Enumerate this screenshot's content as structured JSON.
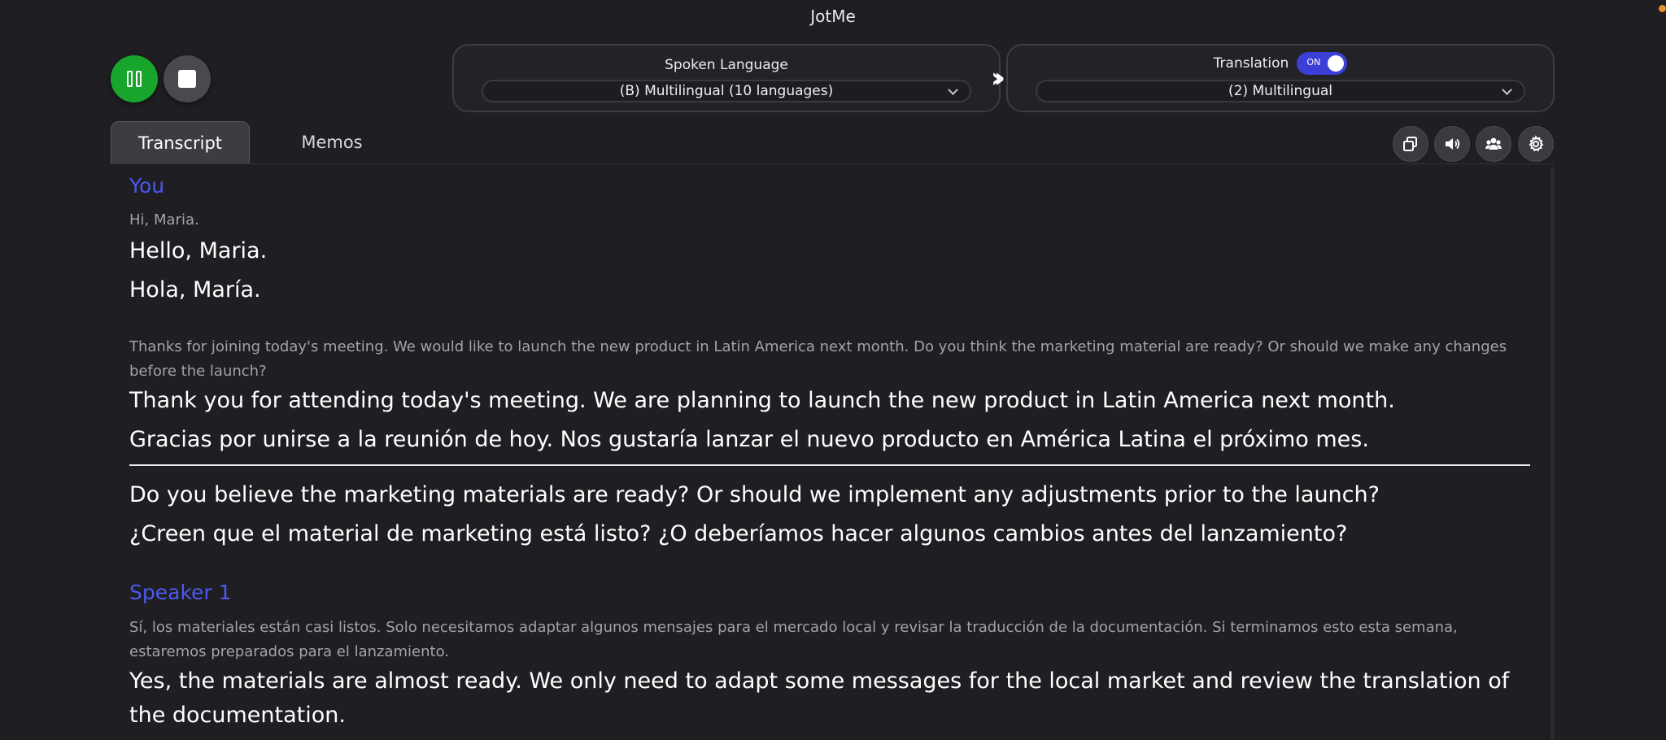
{
  "app": {
    "title": "JotMe"
  },
  "controls": {
    "pause_icon": "pause-icon",
    "stop_icon": "stop-icon"
  },
  "spoken_language": {
    "label": "Spoken Language",
    "selected": "(B) Multilingual (10 languages)"
  },
  "translation": {
    "label": "Translation",
    "toggle_text": "ON",
    "enabled": true,
    "selected": "(2) Multilingual"
  },
  "tabs": [
    {
      "label": "Transcript",
      "active": true
    },
    {
      "label": "Memos",
      "active": false
    }
  ],
  "toolbar": {
    "icons": [
      "windows-icon",
      "speaker-icon",
      "people-icon",
      "gear-icon"
    ]
  },
  "transcript": [
    {
      "speaker": "You",
      "segments": [
        {
          "original": "Hi, Maria.",
          "lines": [
            "Hello, Maria.",
            "Hola, María."
          ]
        },
        {
          "original": "Thanks for joining today's meeting. We would like to launch the new product in Latin America next month. Do you think the marketing material are ready? Or should we make any changes before the launch?",
          "lines": [
            "Thank you for attending today's meeting. We are planning to launch the new product in Latin America next month.",
            "Gracias por unirse a la reunión de hoy. Nos gustaría lanzar el nuevo producto en América Latina el próximo mes.",
            "Do you believe the marketing materials are ready? Or should we implement any adjustments prior to the launch?",
            "¿Creen que el material de marketing está listo? ¿O deberíamos hacer algunos cambios antes del lanzamiento?"
          ]
        }
      ]
    },
    {
      "speaker": "Speaker 1",
      "segments": [
        {
          "original": "Sí, los materiales están casi listos. Solo necesitamos adaptar algunos mensajes para el mercado local y revisar la traducción de la documentación. Si terminamos esto esta semana, estaremos preparados para el lanzamiento.",
          "lines": [
            "Yes, the materials are almost ready. We only need to adapt some messages for the local market and review the translation of the documentation."
          ]
        }
      ]
    }
  ],
  "colors": {
    "accent": "#4c59f0",
    "play_green": "#17a52c",
    "toggle_blue": "#3c3fd6",
    "background": "#1f1e22"
  }
}
